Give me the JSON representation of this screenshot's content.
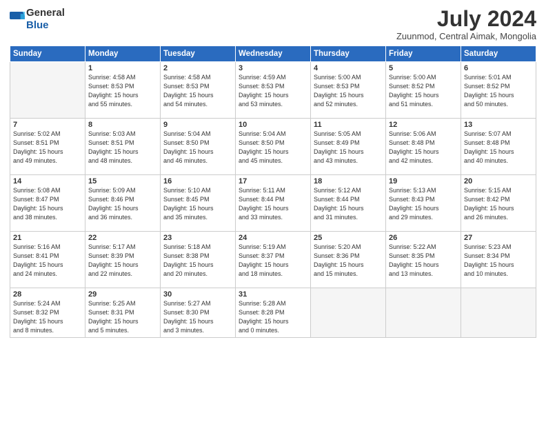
{
  "header": {
    "logo_general": "General",
    "logo_blue": "Blue",
    "month_title": "July 2024",
    "subtitle": "Zuunmod, Central Aimak, Mongolia"
  },
  "weekdays": [
    "Sunday",
    "Monday",
    "Tuesday",
    "Wednesday",
    "Thursday",
    "Friday",
    "Saturday"
  ],
  "weeks": [
    [
      {
        "day": "",
        "info": ""
      },
      {
        "day": "1",
        "info": "Sunrise: 4:58 AM\nSunset: 8:53 PM\nDaylight: 15 hours\nand 55 minutes."
      },
      {
        "day": "2",
        "info": "Sunrise: 4:58 AM\nSunset: 8:53 PM\nDaylight: 15 hours\nand 54 minutes."
      },
      {
        "day": "3",
        "info": "Sunrise: 4:59 AM\nSunset: 8:53 PM\nDaylight: 15 hours\nand 53 minutes."
      },
      {
        "day": "4",
        "info": "Sunrise: 5:00 AM\nSunset: 8:53 PM\nDaylight: 15 hours\nand 52 minutes."
      },
      {
        "day": "5",
        "info": "Sunrise: 5:00 AM\nSunset: 8:52 PM\nDaylight: 15 hours\nand 51 minutes."
      },
      {
        "day": "6",
        "info": "Sunrise: 5:01 AM\nSunset: 8:52 PM\nDaylight: 15 hours\nand 50 minutes."
      }
    ],
    [
      {
        "day": "7",
        "info": "Sunrise: 5:02 AM\nSunset: 8:51 PM\nDaylight: 15 hours\nand 49 minutes."
      },
      {
        "day": "8",
        "info": "Sunrise: 5:03 AM\nSunset: 8:51 PM\nDaylight: 15 hours\nand 48 minutes."
      },
      {
        "day": "9",
        "info": "Sunrise: 5:04 AM\nSunset: 8:50 PM\nDaylight: 15 hours\nand 46 minutes."
      },
      {
        "day": "10",
        "info": "Sunrise: 5:04 AM\nSunset: 8:50 PM\nDaylight: 15 hours\nand 45 minutes."
      },
      {
        "day": "11",
        "info": "Sunrise: 5:05 AM\nSunset: 8:49 PM\nDaylight: 15 hours\nand 43 minutes."
      },
      {
        "day": "12",
        "info": "Sunrise: 5:06 AM\nSunset: 8:48 PM\nDaylight: 15 hours\nand 42 minutes."
      },
      {
        "day": "13",
        "info": "Sunrise: 5:07 AM\nSunset: 8:48 PM\nDaylight: 15 hours\nand 40 minutes."
      }
    ],
    [
      {
        "day": "14",
        "info": "Sunrise: 5:08 AM\nSunset: 8:47 PM\nDaylight: 15 hours\nand 38 minutes."
      },
      {
        "day": "15",
        "info": "Sunrise: 5:09 AM\nSunset: 8:46 PM\nDaylight: 15 hours\nand 36 minutes."
      },
      {
        "day": "16",
        "info": "Sunrise: 5:10 AM\nSunset: 8:45 PM\nDaylight: 15 hours\nand 35 minutes."
      },
      {
        "day": "17",
        "info": "Sunrise: 5:11 AM\nSunset: 8:44 PM\nDaylight: 15 hours\nand 33 minutes."
      },
      {
        "day": "18",
        "info": "Sunrise: 5:12 AM\nSunset: 8:44 PM\nDaylight: 15 hours\nand 31 minutes."
      },
      {
        "day": "19",
        "info": "Sunrise: 5:13 AM\nSunset: 8:43 PM\nDaylight: 15 hours\nand 29 minutes."
      },
      {
        "day": "20",
        "info": "Sunrise: 5:15 AM\nSunset: 8:42 PM\nDaylight: 15 hours\nand 26 minutes."
      }
    ],
    [
      {
        "day": "21",
        "info": "Sunrise: 5:16 AM\nSunset: 8:41 PM\nDaylight: 15 hours\nand 24 minutes."
      },
      {
        "day": "22",
        "info": "Sunrise: 5:17 AM\nSunset: 8:39 PM\nDaylight: 15 hours\nand 22 minutes."
      },
      {
        "day": "23",
        "info": "Sunrise: 5:18 AM\nSunset: 8:38 PM\nDaylight: 15 hours\nand 20 minutes."
      },
      {
        "day": "24",
        "info": "Sunrise: 5:19 AM\nSunset: 8:37 PM\nDaylight: 15 hours\nand 18 minutes."
      },
      {
        "day": "25",
        "info": "Sunrise: 5:20 AM\nSunset: 8:36 PM\nDaylight: 15 hours\nand 15 minutes."
      },
      {
        "day": "26",
        "info": "Sunrise: 5:22 AM\nSunset: 8:35 PM\nDaylight: 15 hours\nand 13 minutes."
      },
      {
        "day": "27",
        "info": "Sunrise: 5:23 AM\nSunset: 8:34 PM\nDaylight: 15 hours\nand 10 minutes."
      }
    ],
    [
      {
        "day": "28",
        "info": "Sunrise: 5:24 AM\nSunset: 8:32 PM\nDaylight: 15 hours\nand 8 minutes."
      },
      {
        "day": "29",
        "info": "Sunrise: 5:25 AM\nSunset: 8:31 PM\nDaylight: 15 hours\nand 5 minutes."
      },
      {
        "day": "30",
        "info": "Sunrise: 5:27 AM\nSunset: 8:30 PM\nDaylight: 15 hours\nand 3 minutes."
      },
      {
        "day": "31",
        "info": "Sunrise: 5:28 AM\nSunset: 8:28 PM\nDaylight: 15 hours\nand 0 minutes."
      },
      {
        "day": "",
        "info": ""
      },
      {
        "day": "",
        "info": ""
      },
      {
        "day": "",
        "info": ""
      }
    ]
  ]
}
